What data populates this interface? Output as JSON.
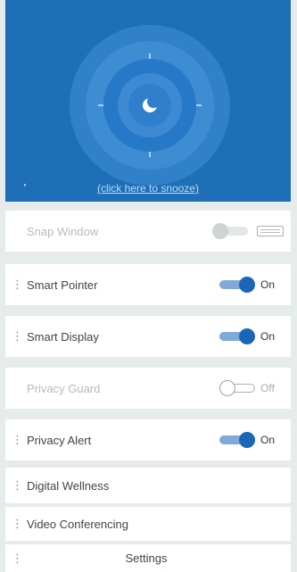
{
  "header": {
    "snooze_link": "(click here to snooze)",
    "moon_icon": "crescent-moon-icon",
    "info_icon": "info-icon",
    "accent_color": "#1e6fb5"
  },
  "rows": [
    {
      "label": "Snap Window",
      "state": "disabled",
      "value": "",
      "extra_icon": "keyboard-icon"
    },
    {
      "label": "Smart Pointer",
      "state": "on",
      "value": "On"
    },
    {
      "label": "Smart Display",
      "state": "on",
      "value": "On"
    },
    {
      "label": "Privacy Guard",
      "state": "off",
      "value": "Off"
    },
    {
      "label": "Privacy Alert",
      "state": "on",
      "value": "On"
    },
    {
      "label": "Digital Wellness"
    },
    {
      "label": "Video Conferencing"
    }
  ],
  "settings_label": "Settings",
  "colors": {
    "toggle_on_knob": "#1c66b8",
    "toggle_on_track": "#7fa9d6",
    "row_bg": "#ffffff",
    "separator": "#e6eceb"
  }
}
